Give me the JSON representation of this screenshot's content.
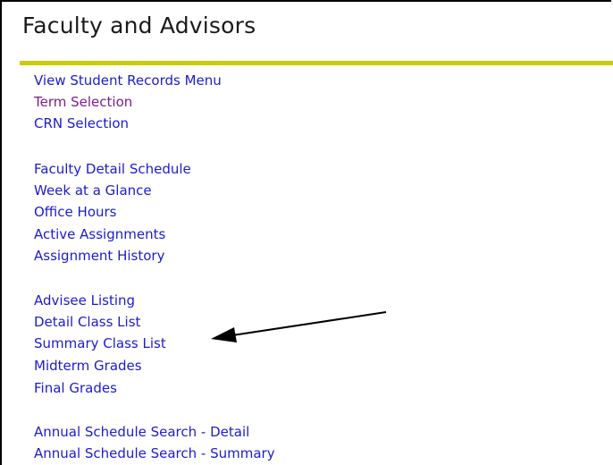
{
  "page": {
    "title": "Faculty and Advisors"
  },
  "colors": {
    "rule": "#cccc00",
    "link": "#1c1ccc",
    "visited_link": "#7a1f8a",
    "arrow": "#000000"
  },
  "menu": {
    "group1": [
      {
        "label": "View Student Records Menu",
        "visited": false
      },
      {
        "label": "Term Selection",
        "visited": true
      },
      {
        "label": "CRN Selection",
        "visited": false
      }
    ],
    "group2": [
      {
        "label": "Faculty Detail Schedule",
        "visited": false
      },
      {
        "label": "Week at a Glance",
        "visited": false
      },
      {
        "label": "Office Hours",
        "visited": false
      },
      {
        "label": "Active Assignments",
        "visited": false
      },
      {
        "label": "Assignment History",
        "visited": false
      }
    ],
    "group3": [
      {
        "label": "Advisee Listing",
        "visited": false
      },
      {
        "label": "Detail Class List",
        "visited": false
      },
      {
        "label": "Summary Class List",
        "visited": false
      },
      {
        "label": "Midterm Grades",
        "visited": false
      },
      {
        "label": "Final Grades",
        "visited": false
      }
    ],
    "group4": [
      {
        "label": "Annual Schedule Search - Detail",
        "visited": false
      },
      {
        "label": "Annual Schedule Search - Summary",
        "visited": false
      }
    ]
  },
  "annotation": {
    "arrow_target": "Summary Class List"
  }
}
